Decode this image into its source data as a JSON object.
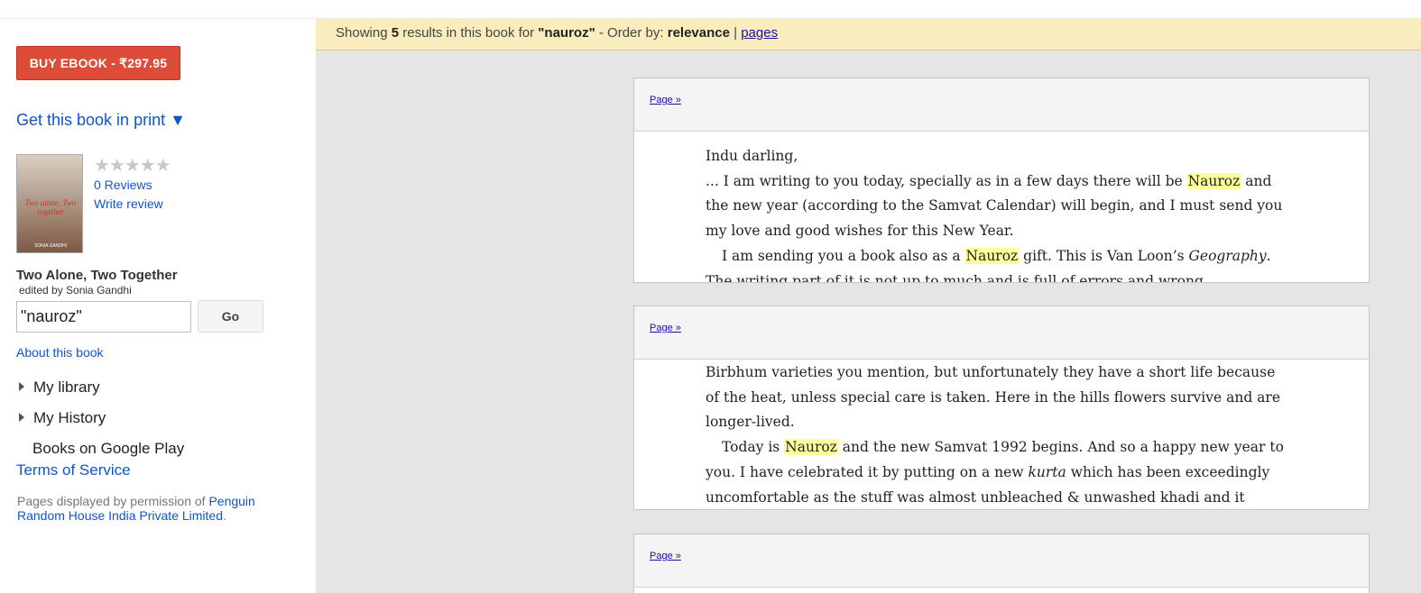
{
  "sidebar": {
    "buy_button": "BUY EBOOK - ₹297.95",
    "print_link": "Get this book in print ▼",
    "cover_title": "Two alone, Two together",
    "cover_author": "SONIA GANDHI",
    "stars": "★★★★★",
    "reviews": "0 Reviews",
    "write_review": "Write review",
    "book_title": "Two Alone, Two Together",
    "book_author": "edited by Sonia Gandhi",
    "search_value": "\"nauroz\"",
    "go_button": "Go",
    "about": "About this book",
    "my_library": "My library",
    "my_history": "My History",
    "google_play": "Books on Google Play",
    "terms": "Terms of Service",
    "permission_prefix": "Pages displayed by permission of ",
    "permission_link": "Penguin Random House India Private Limited",
    "permission_suffix": "."
  },
  "results": {
    "showing": "Showing ",
    "count": "5",
    "mid": " results in this book for ",
    "query": "\"nauroz\"",
    "order_label": " - Order by: ",
    "order_active": "relevance",
    "sep": " | ",
    "order_pages": "pages"
  },
  "snippets": [
    {
      "page_link": "Page »",
      "lines": [
        [
          "Indu darling,"
        ],
        [
          "... I am writing to you today, specially as in a few days there will be ",
          "Nauroz",
          " and"
        ],
        [
          "the new year (according to the Samvat Calendar) will begin, and I must send you"
        ],
        [
          "my love and good wishes for this New Year."
        ],
        [
          "I am sending you a book also as a ",
          "Nauroz",
          " gift. This is Van Loon’s ",
          "Geography",
          "."
        ],
        [
          "The writing part of it is not up to much and is full of errors and wrong"
        ]
      ]
    },
    {
      "page_link": "Page »",
      "lines": [
        [
          "Birbhum varieties you mention, but unfortunately they have a short life because"
        ],
        [
          "of the heat, unless special care is taken. Here in the hills flowers survive and are"
        ],
        [
          "longer-lived."
        ],
        [
          "Today is ",
          "Nauroz",
          " and the new Samvat 1992 begins. And so a happy new year to"
        ],
        [
          "you. I have celebrated it by putting on a new ",
          "kurta",
          " which has been exceedingly"
        ],
        [
          "uncomfortable as the stuff was almost unbleached & unwashed khadi and it"
        ]
      ]
    },
    {
      "page_link": "Page »",
      "lines": []
    }
  ]
}
